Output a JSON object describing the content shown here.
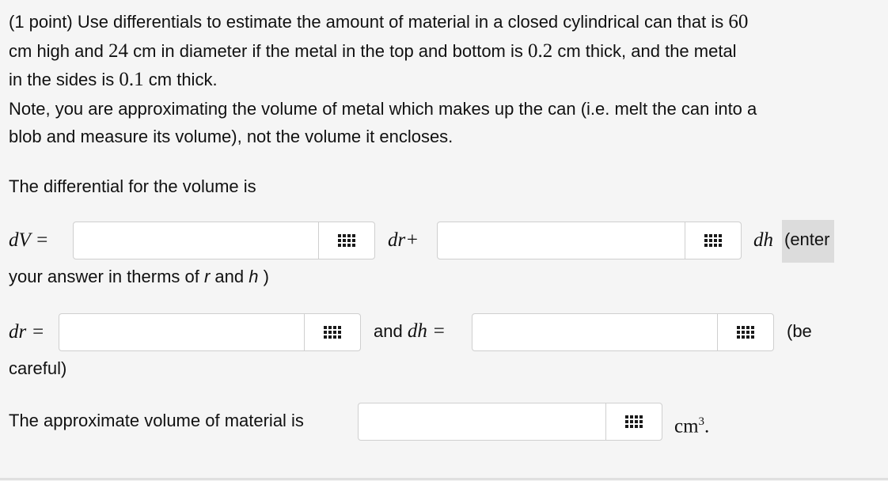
{
  "problem": {
    "line1_pre": "(1 point) Use differentials to estimate the amount of material in a closed cylindrical can that is ",
    "height_value": "60",
    "line2_a": "cm high and ",
    "diameter_value": "24",
    "line2_b": " cm in diameter if the metal in the top and bottom is ",
    "topbottom_thickness": "0.2",
    "line2_c": " cm thick, and the metal",
    "line3_a": "in the sides is ",
    "side_thickness": "0.1",
    "line3_b": " cm thick.",
    "note_line1": "Note, you are approximating the volume of metal which makes up the can (i.e. melt the can into a",
    "note_line2": "blob and measure its volume), not the volume it encloses."
  },
  "differential": {
    "heading": "The differential for the volume is",
    "dV_label": "dV =",
    "dr_plus": "dr+",
    "dh_label": "dh",
    "enter_text": "(enter",
    "continuation": "your answer in therms of ",
    "r_var": "r",
    "and_text": " and ",
    "h_var": "h",
    "close_paren": " )"
  },
  "increments": {
    "dr_label": "dr =",
    "and_text": "and ",
    "dh_label": "dh =",
    "be_text": "(be",
    "careful_text": "careful)"
  },
  "volume": {
    "label": "The approximate volume of material is",
    "unit": "cm",
    "unit_exp": "3",
    "period": "."
  },
  "inputs": {
    "dV_dr_value": "",
    "dV_dh_value": "",
    "dr_value": "",
    "dh_value": "",
    "volume_value": ""
  },
  "icons": {
    "palette": "equation-palette-icon"
  },
  "colors": {
    "background": "#f5f5f5",
    "input_border": "#cfcfcf",
    "highlight": "#dcdcdc"
  }
}
